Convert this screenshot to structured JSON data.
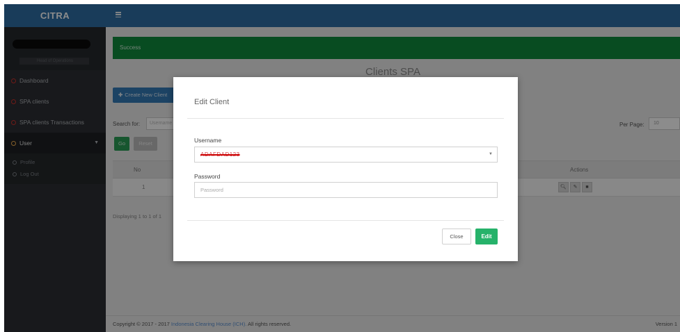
{
  "app": {
    "brand": "CITRA"
  },
  "sidebar": {
    "user_sub": "Head of Operations",
    "items": [
      {
        "label": "Dashboard"
      },
      {
        "label": "SPA clients"
      },
      {
        "label": "SPA clients Transactions"
      },
      {
        "label": "User"
      }
    ],
    "sub_items": [
      {
        "label": "Profile"
      },
      {
        "label": "Log Out"
      }
    ]
  },
  "alert": {
    "text": "Success"
  },
  "page": {
    "heading": "Clients SPA",
    "create_button": "Create New Client",
    "search_label": "Search for:",
    "search_placeholder": "Username",
    "per_page_label": "Per Page:",
    "per_page_value": "10",
    "go_button": "Go",
    "reset_button": "Reset",
    "displaying": "Displaying 1 to 1 of 1"
  },
  "table": {
    "headers": {
      "no": "No",
      "actions": "Actions"
    },
    "rows": [
      {
        "no": "1"
      }
    ]
  },
  "footer": {
    "prefix": "Copyright © 2017 - 2017",
    "link": "Indonesia Clearing House (ICH).",
    "suffix": "All rights reserved.",
    "version": "Version 1"
  },
  "modal": {
    "title": "Edit Client",
    "username_label": "Username",
    "username_value": "ADAFDAD123",
    "password_label": "Password",
    "password_placeholder": "Password",
    "close_button": "Close",
    "edit_button": "Edit"
  },
  "colors": {
    "topbar": "#2e6da4",
    "sidebar": "#2c2f33",
    "alert_success": "#0f8a3d",
    "edit_button": "#26b26a"
  }
}
